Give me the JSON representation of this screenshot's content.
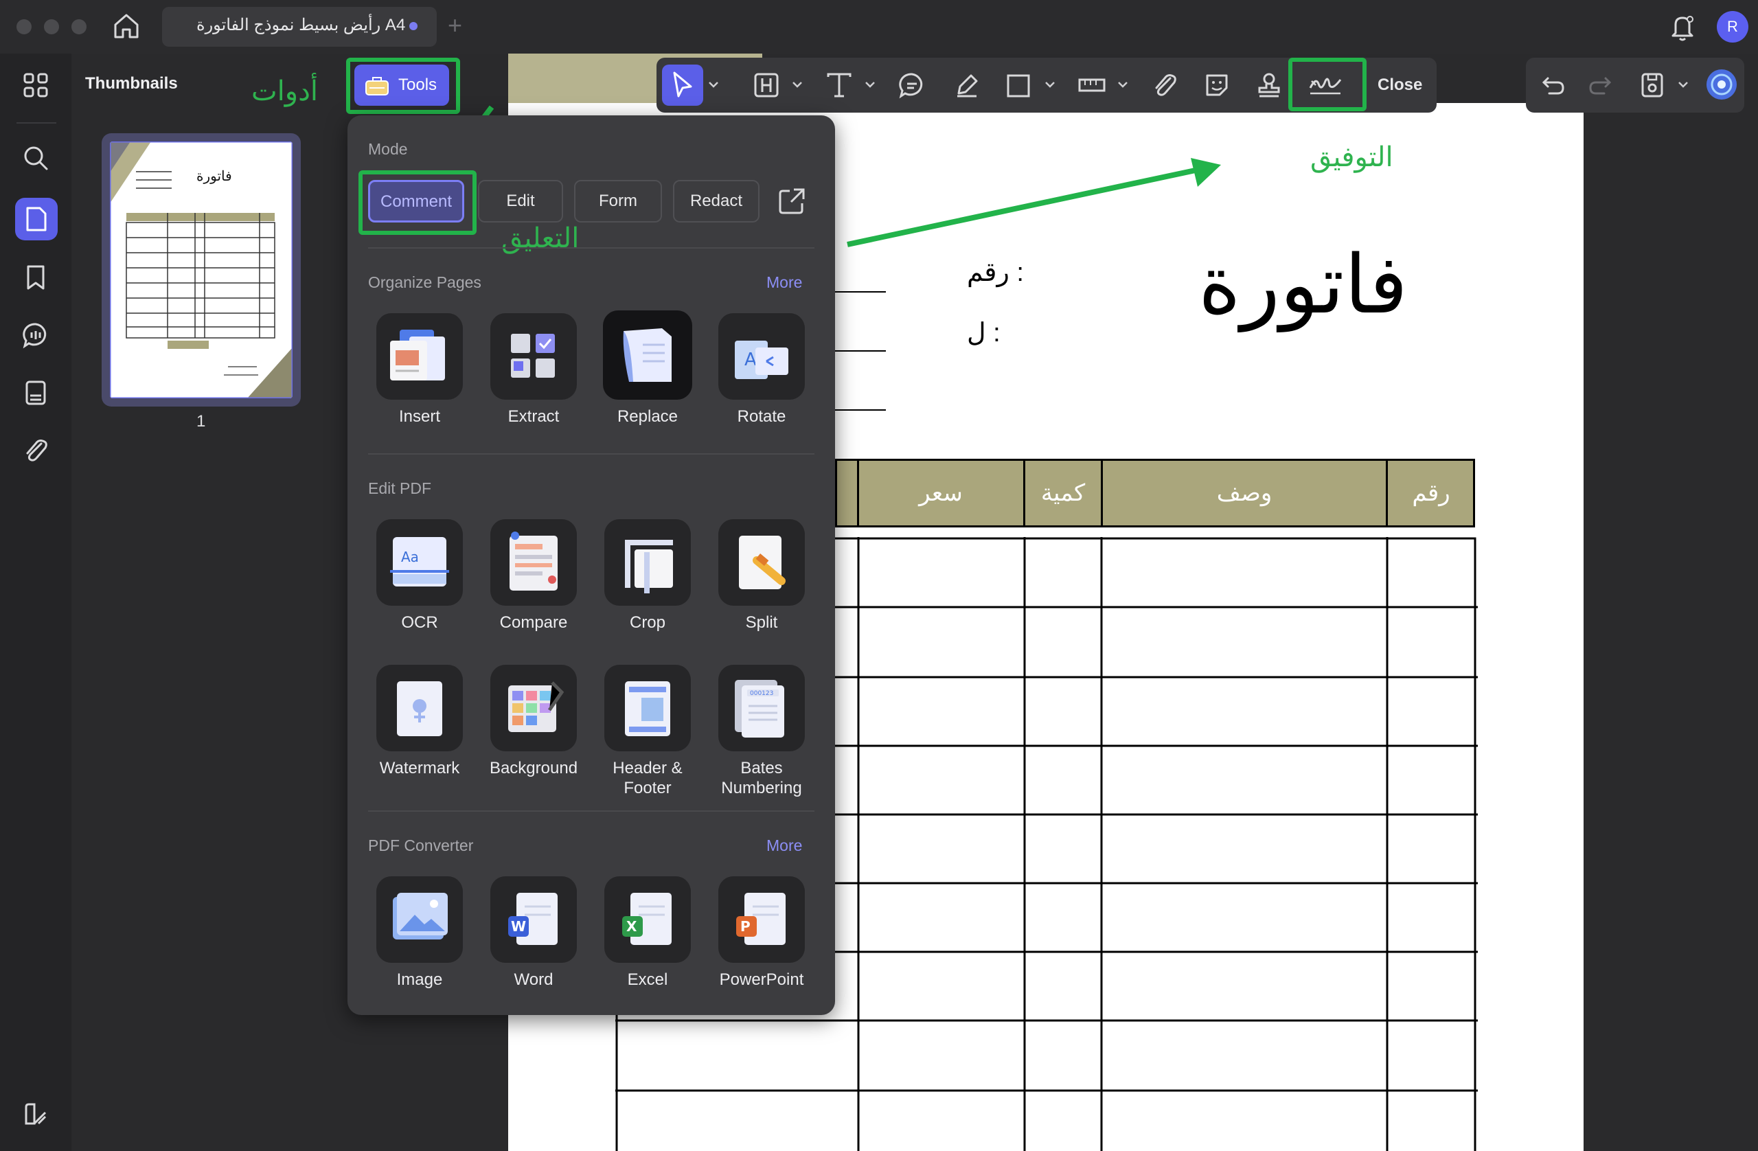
{
  "window": {
    "tab_title": "رأيض بسيط نموذج الفاتورة A4",
    "avatar_initial": "R"
  },
  "sidebar": {
    "panel_title": "Thumbnails",
    "page_number": "1",
    "thumb_title": "فاتورة"
  },
  "toolbar": {
    "tools_label": "Tools",
    "close_label": "Close"
  },
  "annotations": {
    "tools_ar": "أدوات",
    "comment_ar": "التعليق",
    "signature_ar": "التوفيق"
  },
  "popup": {
    "mode_title": "Mode",
    "modes": [
      "Comment",
      "Edit",
      "Form",
      "Redact"
    ],
    "active_mode": "Comment",
    "organize_title": "Organize Pages",
    "more_label": "More",
    "organize": [
      "Insert",
      "Extract",
      "Replace",
      "Rotate"
    ],
    "edit_title": "Edit PDF",
    "edit_row1": [
      "OCR",
      "Compare",
      "Crop",
      "Split"
    ],
    "edit_row2": [
      "Watermark",
      "Background",
      "Header & Footer",
      "Bates Numbering"
    ],
    "converter_title": "PDF Converter",
    "converter": [
      "Image",
      "Word",
      "Excel",
      "PowerPoint"
    ]
  },
  "document": {
    "title": "فاتورة",
    "number_label": "رقم :",
    "to_label": "ل :",
    "headers": [
      "رقم",
      "وصف",
      "كمية",
      "سعر"
    ]
  },
  "colors": {
    "accent": "#5b5fe8",
    "highlight_green": "#22b34a",
    "table_header": "#aaa67c"
  }
}
